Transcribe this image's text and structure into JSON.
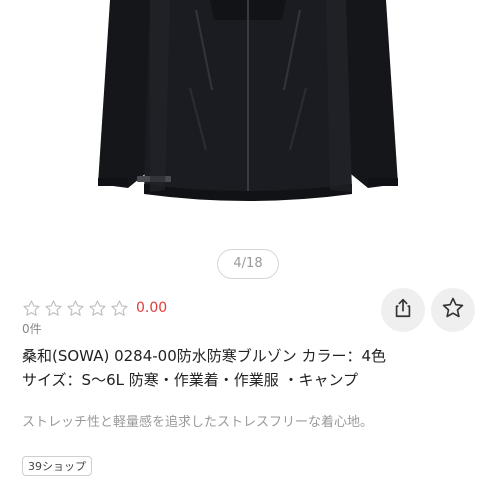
{
  "image": {
    "subject": "jacket-photo",
    "colors": {
      "background": "#ffffff",
      "jacket": "#16171b",
      "trim": "#2a2b30"
    }
  },
  "pager": {
    "text": "4/18"
  },
  "rating": {
    "stars_filled": 0,
    "stars_total": 5,
    "score": "0.00",
    "review_count": "0件",
    "score_color": "#e23a3a"
  },
  "product": {
    "title_line1": "桑和(SOWA) 0284-00防水防寒ブルゾン カラー：4色",
    "title_line2": "サイズ：S〜6L  防寒・作業着・作業服 ・キャンプ",
    "description": "ストレッチ性と軽量感を追求したストレスフリーな着心地。"
  },
  "actions": {
    "share_icon": "share-icon",
    "favorite_icon": "star-outline-icon"
  },
  "shop": {
    "badge": "39ショップ"
  }
}
